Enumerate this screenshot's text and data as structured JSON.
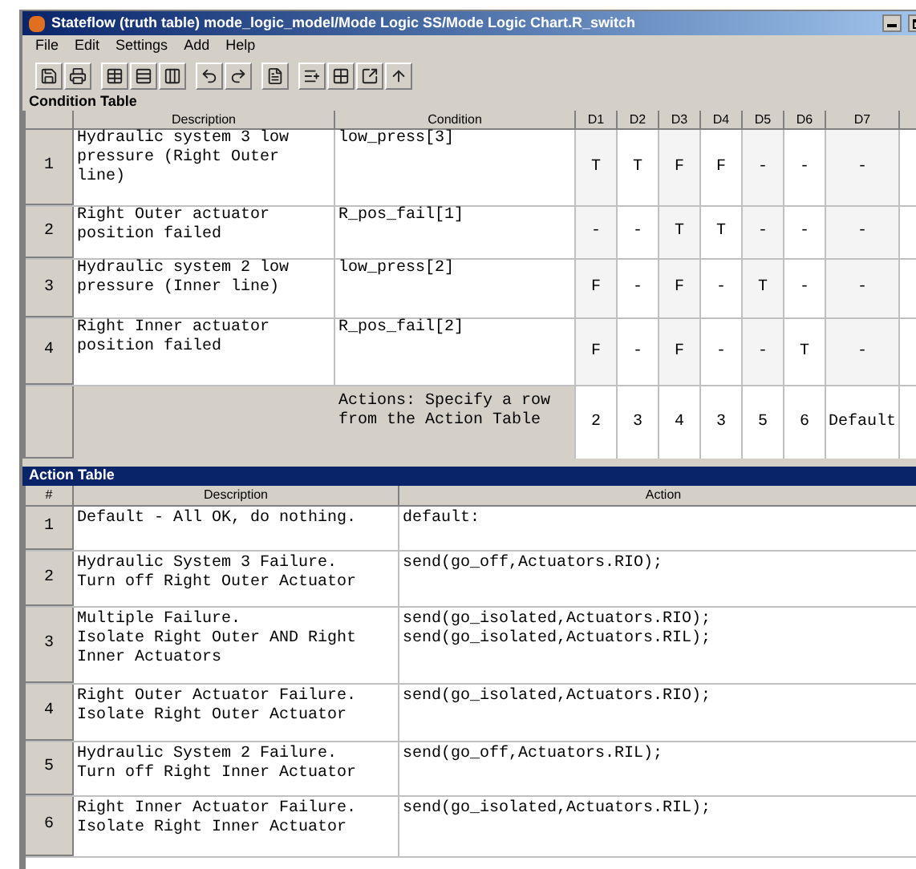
{
  "window": {
    "title": "Stateflow (truth table) mode_logic_model/Mode Logic SS/Mode Logic Chart.R_switch"
  },
  "menu": [
    "File",
    "Edit",
    "Settings",
    "Add",
    "Help"
  ],
  "condition_table": {
    "title": "Condition Table",
    "columns": [
      "Description",
      "Condition",
      "D1",
      "D2",
      "D3",
      "D4",
      "D5",
      "D6",
      "D7"
    ],
    "rows": [
      {
        "number": "1",
        "description": "Hydraulic system 3 low pressure (Right Outer line)",
        "condition": "low_press[3]",
        "decisions": [
          "T",
          "T",
          "F",
          "F",
          "-",
          "-",
          "-"
        ]
      },
      {
        "number": "2",
        "description": "Right Outer actuator position failed",
        "condition": "R_pos_fail[1]",
        "decisions": [
          "-",
          "-",
          "T",
          "T",
          "-",
          "-",
          "-"
        ]
      },
      {
        "number": "3",
        "description": "Hydraulic system 2 low pressure (Inner line)",
        "condition": "low_press[2]",
        "decisions": [
          "F",
          "-",
          "F",
          "-",
          "T",
          "-",
          "-"
        ]
      },
      {
        "number": "4",
        "description": "Right Inner actuator position failed",
        "condition": "R_pos_fail[2]",
        "decisions": [
          "F",
          "-",
          "F",
          "-",
          "-",
          "T",
          "-"
        ]
      }
    ],
    "actions_row": {
      "label": "Actions: Specify a row from the Action Table",
      "values": [
        "2",
        "3",
        "4",
        "3",
        "5",
        "6",
        "Default"
      ]
    }
  },
  "action_table": {
    "title": "Action Table",
    "columns": [
      "#",
      "Description",
      "Action"
    ],
    "rows": [
      {
        "number": "1",
        "description": "Default - All OK, do nothing.",
        "action": [
          "default:"
        ]
      },
      {
        "number": "2",
        "description": "Hydraulic System 3 Failure.\nTurn off Right Outer Actuator",
        "action": [
          "send(go_off,Actuators.RIO);"
        ]
      },
      {
        "number": "3",
        "description": "Multiple Failure.\nIsolate Right Outer AND Right Inner Actuators",
        "action": [
          "send(go_isolated,Actuators.RIO);",
          "send(go_isolated,Actuators.RIL);"
        ]
      },
      {
        "number": "4",
        "description": "Right Outer Actuator Failure.\nIsolate Right Outer Actuator",
        "action": [
          "send(go_isolated,Actuators.RIO);"
        ]
      },
      {
        "number": "5",
        "description": "Hydraulic System 2 Failure.\nTurn off Right Inner Actuator",
        "action": [
          "send(go_off,Actuators.RIL);"
        ]
      },
      {
        "number": "6",
        "description": "Right Inner Actuator Failure.\nIsolate Right Inner Actuator",
        "action": [
          "send(go_isolated,Actuators.RIL);"
        ]
      }
    ]
  }
}
